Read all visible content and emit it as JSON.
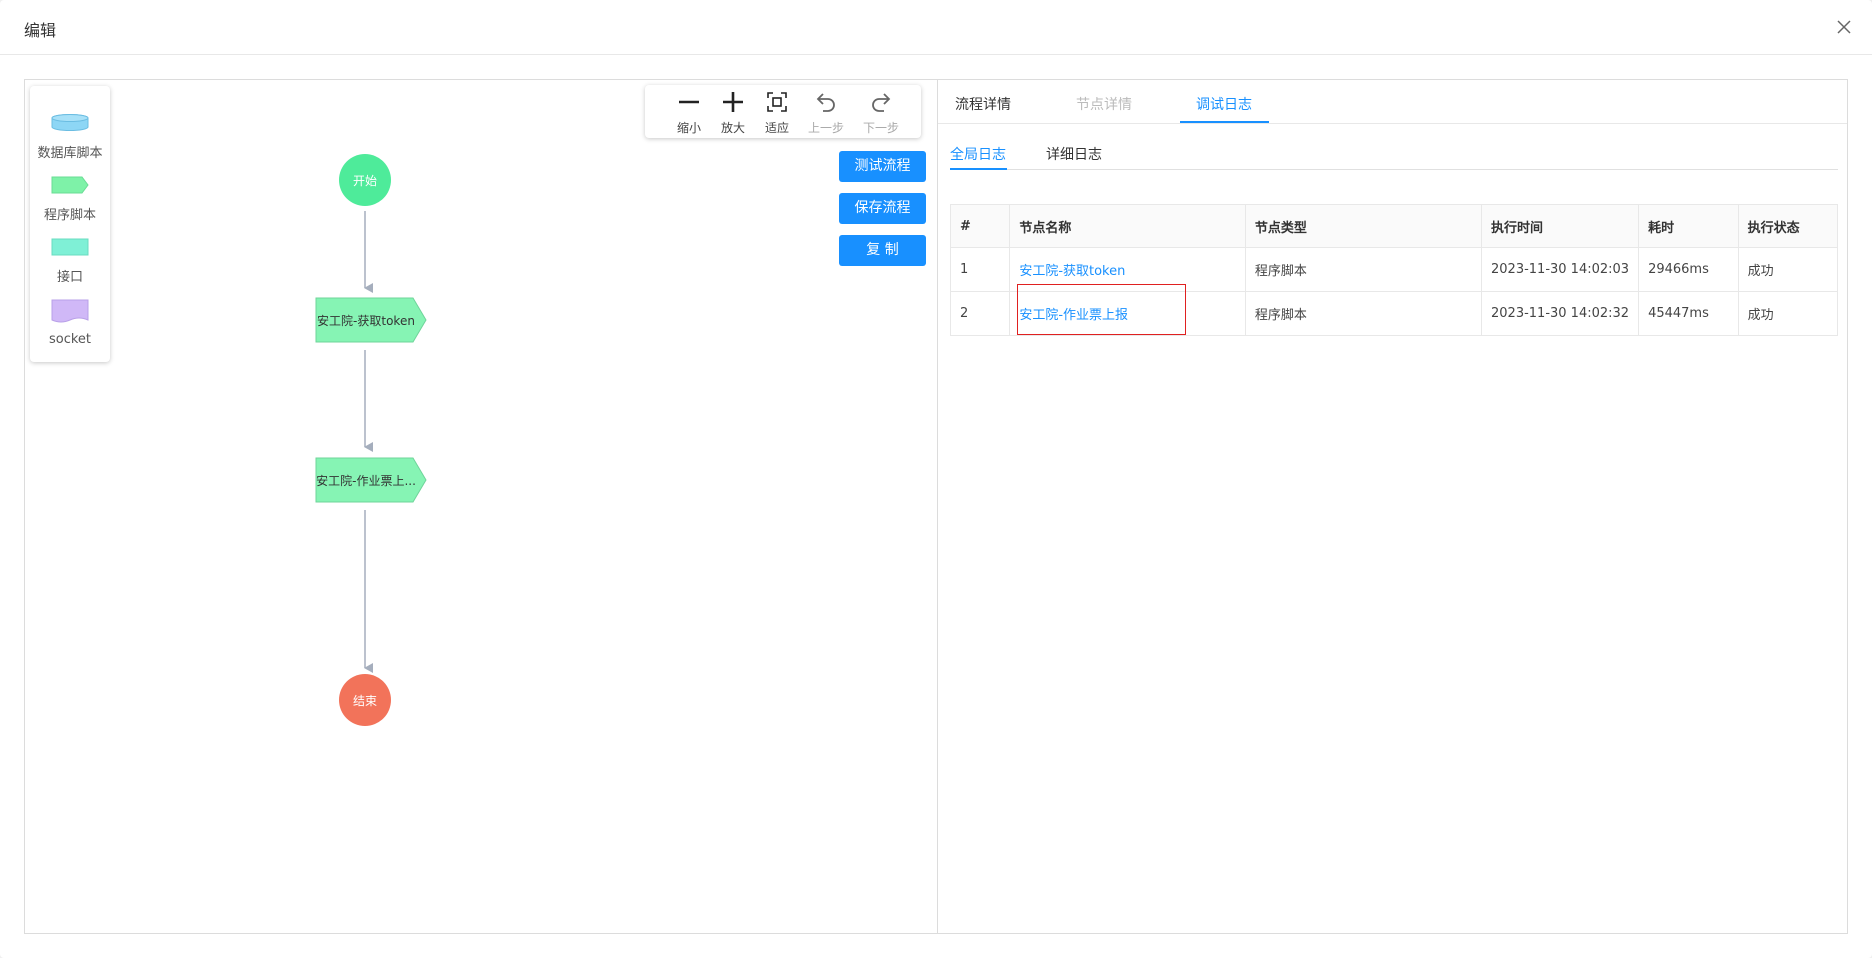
{
  "modal": {
    "title": "编辑"
  },
  "palette": {
    "items": [
      {
        "label": "数据库脚本",
        "icon": "database-icon",
        "color": "#8dd6f5"
      },
      {
        "label": "程序脚本",
        "icon": "pentagon-icon",
        "color": "#7ef2a8"
      },
      {
        "label": "接口",
        "icon": "rectangle-icon",
        "color": "#7ff0d6"
      },
      {
        "label": "socket",
        "icon": "wave-rect-icon",
        "color": "#d0b8f7"
      }
    ]
  },
  "toolbar": {
    "zoom_out": "缩小",
    "zoom_in": "放大",
    "fit": "适应",
    "undo": "上一步",
    "redo": "下一步"
  },
  "actions": {
    "test_flow": "测试流程",
    "save_flow": "保存流程",
    "copy": "复 制"
  },
  "flow": {
    "start": "开始",
    "node1": "安工院-获取token",
    "node2": "安工院-作业票上...",
    "end": "结束",
    "colors": {
      "start": "#4eeb9a",
      "end": "#f2735a",
      "node": "#86f4b4",
      "edge": "#a5aebd"
    }
  },
  "tabs": [
    {
      "label": "流程详情"
    },
    {
      "label": "节点详情"
    },
    {
      "label": "调试日志"
    }
  ],
  "subtabs": [
    {
      "label": "全局日志"
    },
    {
      "label": "详细日志"
    }
  ],
  "log_table": {
    "headers": [
      "#",
      "节点名称",
      "节点类型",
      "执行时间",
      "耗时",
      "执行状态"
    ],
    "rows": [
      {
        "index": "1",
        "name": "安工院-获取token",
        "type": "程序脚本",
        "time": "2023-11-30 14:02:03",
        "duration": "29466ms",
        "status": "成功"
      },
      {
        "index": "2",
        "name": "安工院-作业票上报",
        "type": "程序脚本",
        "time": "2023-11-30 14:02:32",
        "duration": "45447ms",
        "status": "成功"
      }
    ]
  },
  "accent_color": "#1890ff"
}
